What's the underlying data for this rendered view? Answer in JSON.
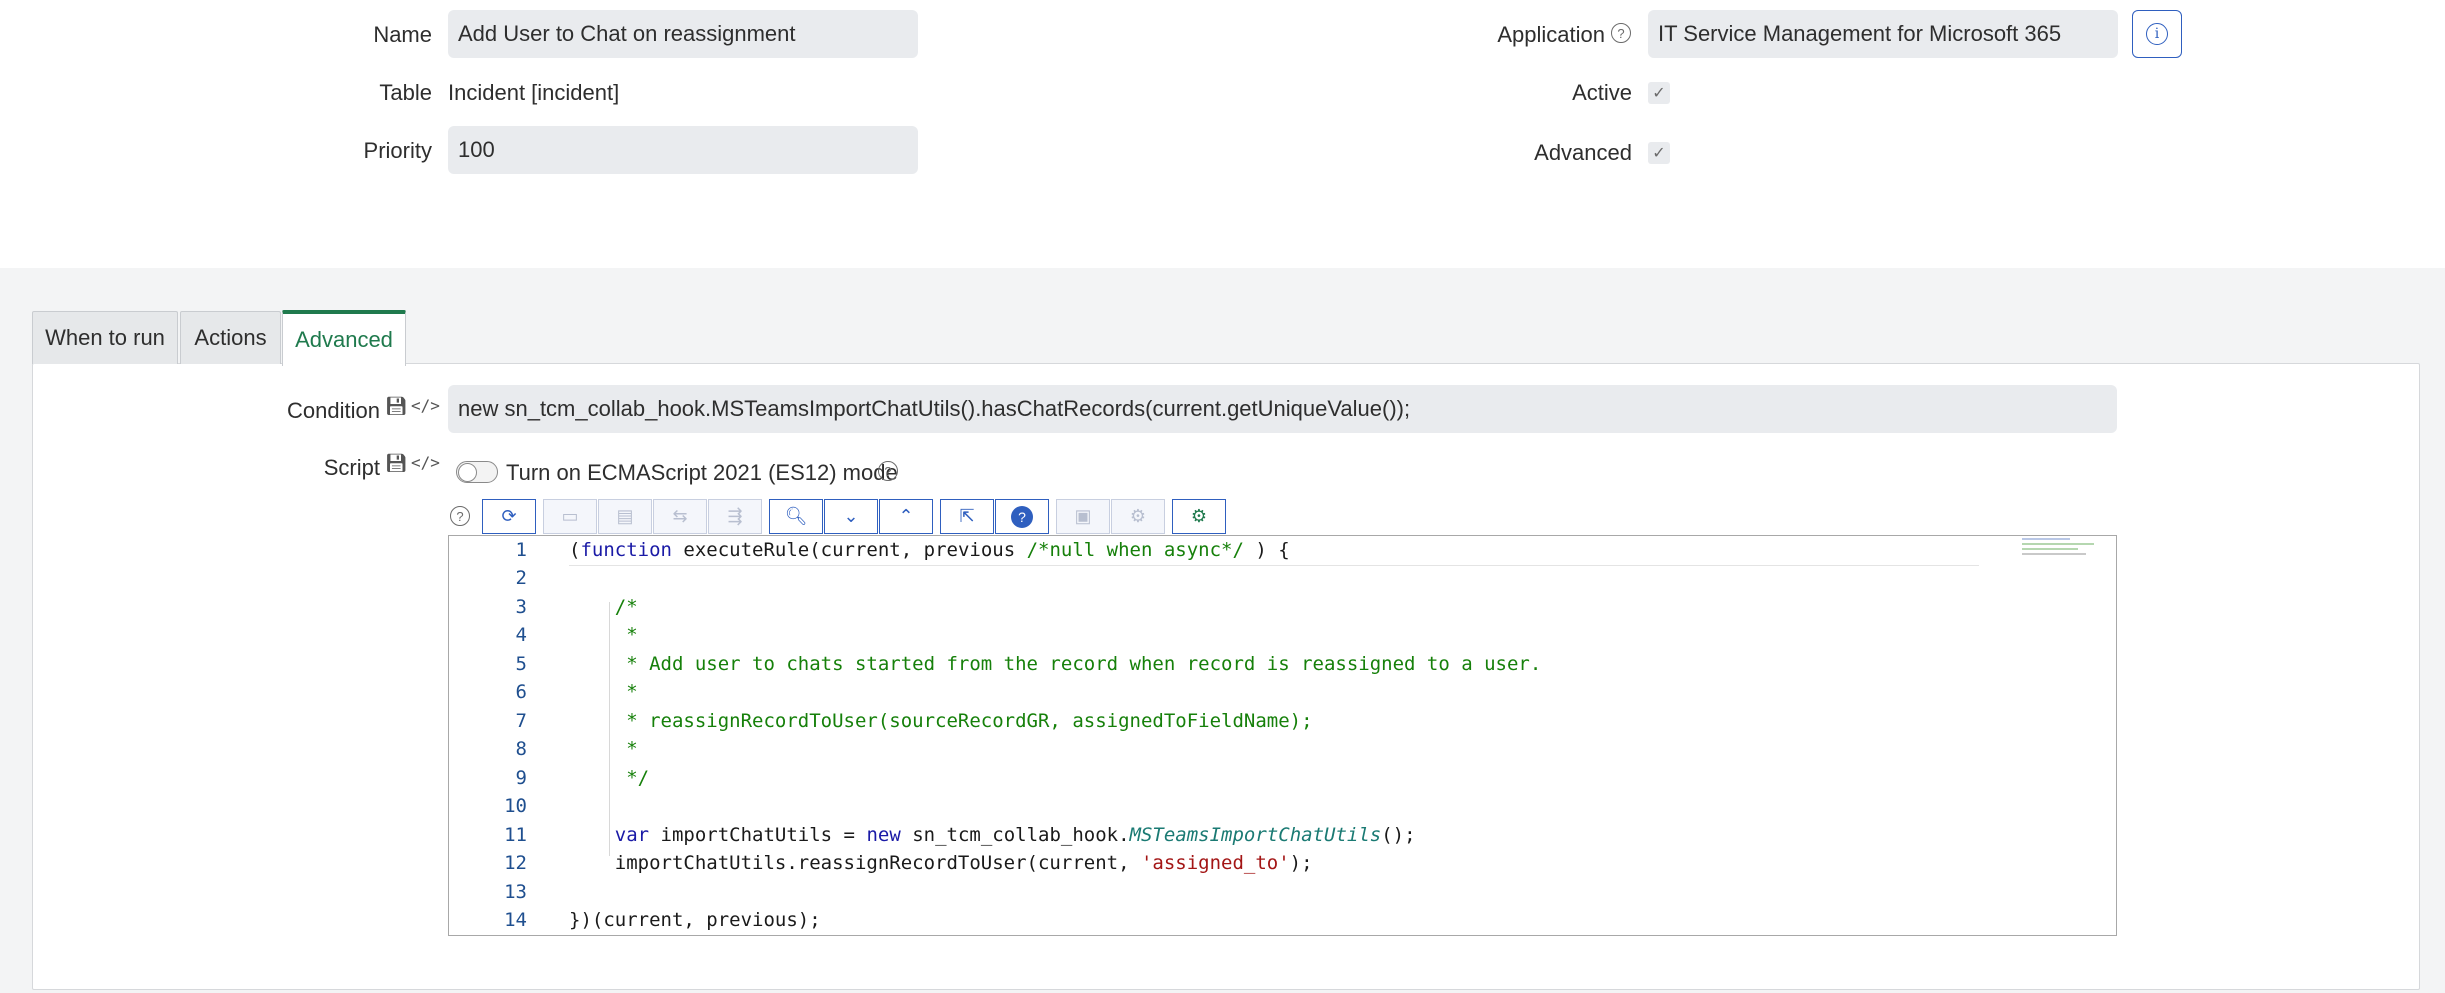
{
  "form": {
    "name_label": "Name",
    "name_value": "Add User to Chat on reassignment",
    "table_label": "Table",
    "table_value": "Incident [incident]",
    "priority_label": "Priority",
    "priority_value": "100",
    "application_label": "Application",
    "application_value": "IT Service Management for Microsoft 365",
    "active_label": "Active",
    "active_checked": true,
    "advanced_label": "Advanced",
    "advanced_checked": true
  },
  "tabs": [
    {
      "label": "When to run",
      "active": false
    },
    {
      "label": "Actions",
      "active": false
    },
    {
      "label": "Advanced",
      "active": true
    }
  ],
  "advanced": {
    "condition_label": "Condition",
    "condition_value": "new sn_tcm_collab_hook.MSTeamsImportChatUtils().hasChatRecords(current.getUniqueValue());",
    "script_label": "Script",
    "es_mode_label": "Turn on ECMAScript 2021 (ES12) mode",
    "es_mode_on": false
  },
  "toolbar": {
    "buttons": [
      {
        "icon": "format-code-icon",
        "enabled": true
      },
      {
        "icon": "comment-icon",
        "enabled": false
      },
      {
        "icon": "uncomment-icon",
        "enabled": false
      },
      {
        "icon": "find-replace-icon",
        "enabled": false
      },
      {
        "icon": "replace-all-icon",
        "enabled": false
      },
      {
        "icon": "search-icon",
        "enabled": true
      },
      {
        "icon": "find-next-icon",
        "enabled": true
      },
      {
        "icon": "find-previous-icon",
        "enabled": true
      },
      {
        "icon": "fullscreen-icon",
        "enabled": true
      },
      {
        "icon": "help-icon",
        "enabled": true
      },
      {
        "icon": "save-icon",
        "enabled": false
      },
      {
        "icon": "script-debugger-icon",
        "enabled": false
      },
      {
        "icon": "syntax-check-icon",
        "enabled": true
      }
    ]
  },
  "code": {
    "lines": [
      "(function executeRule(current, previous /*null when async*/ ) {",
      "",
      "    /*",
      "     *",
      "     * Add user to chats started from the record when record is reassigned to a user.",
      "     *",
      "     * reassignRecordToUser(sourceRecordGR, assignedToFieldName);",
      "     *",
      "     */",
      "",
      "    var importChatUtils = new sn_tcm_collab_hook.MSTeamsImportChatUtils();",
      "    importChatUtils.reassignRecordToUser(current, 'assigned_to');",
      "",
      "})(current, previous);"
    ]
  }
}
